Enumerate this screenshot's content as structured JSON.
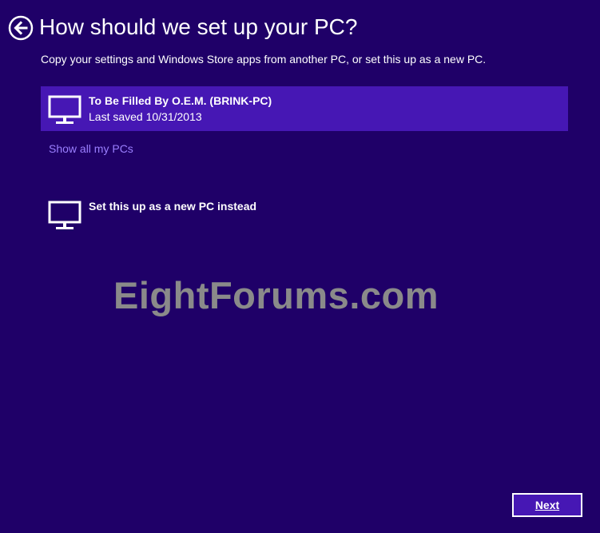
{
  "header": {
    "back_icon": "back-arrow-circle-icon",
    "title": "How should we set up your PC?"
  },
  "subtitle": "Copy your settings and Windows Store apps from another PC, or set this up as a new PC.",
  "pc_list": [
    {
      "name": "To Be Filled By O.E.M. (BRINK-PC)",
      "meta": "Last saved 10/31/2013",
      "icon": "monitor-icon",
      "selected": true
    }
  ],
  "show_all_link": "Show all my PCs",
  "new_pc_option": {
    "name": "Set this up as a new PC instead",
    "icon": "monitor-icon"
  },
  "watermark": "EightForums.com",
  "footer": {
    "next_label": "Next"
  },
  "colors": {
    "background": "#1f0068",
    "selected_item": "#4617b4",
    "link": "#9b7fff",
    "watermark": "#8a8a8a"
  }
}
